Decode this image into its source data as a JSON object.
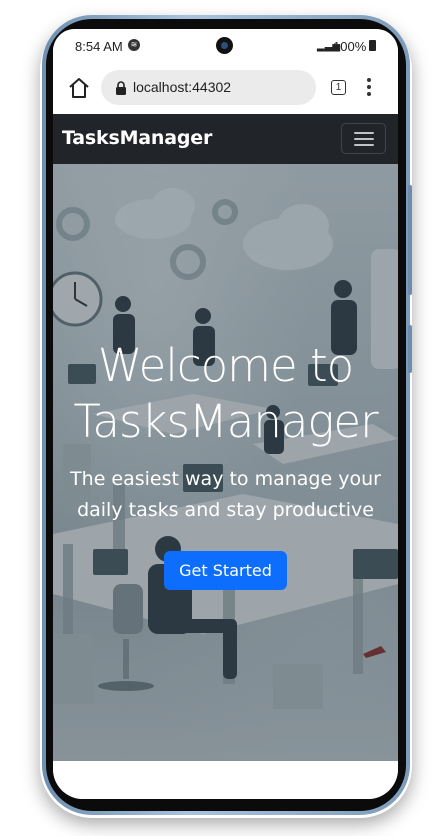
{
  "statusbar": {
    "time": "8:54 AM",
    "battery": "100%",
    "signal_glyph": "▂▃▅"
  },
  "browser": {
    "url": "localhost:44302",
    "tab_count": "1"
  },
  "navbar": {
    "brand": "TasksManager",
    "toggler_icon": "hamburger-icon",
    "background": "#212529"
  },
  "hero": {
    "title": "Welcome to\nTasksManager",
    "subtitle": "The easiest way to manage your\ndaily tasks and stay productive",
    "cta_label": "Get Started",
    "cta_color": "#0d6efd"
  },
  "colors": {
    "accent": "#0d6efd",
    "navbar": "#212529",
    "phone_frame": "#8aa9c8"
  }
}
